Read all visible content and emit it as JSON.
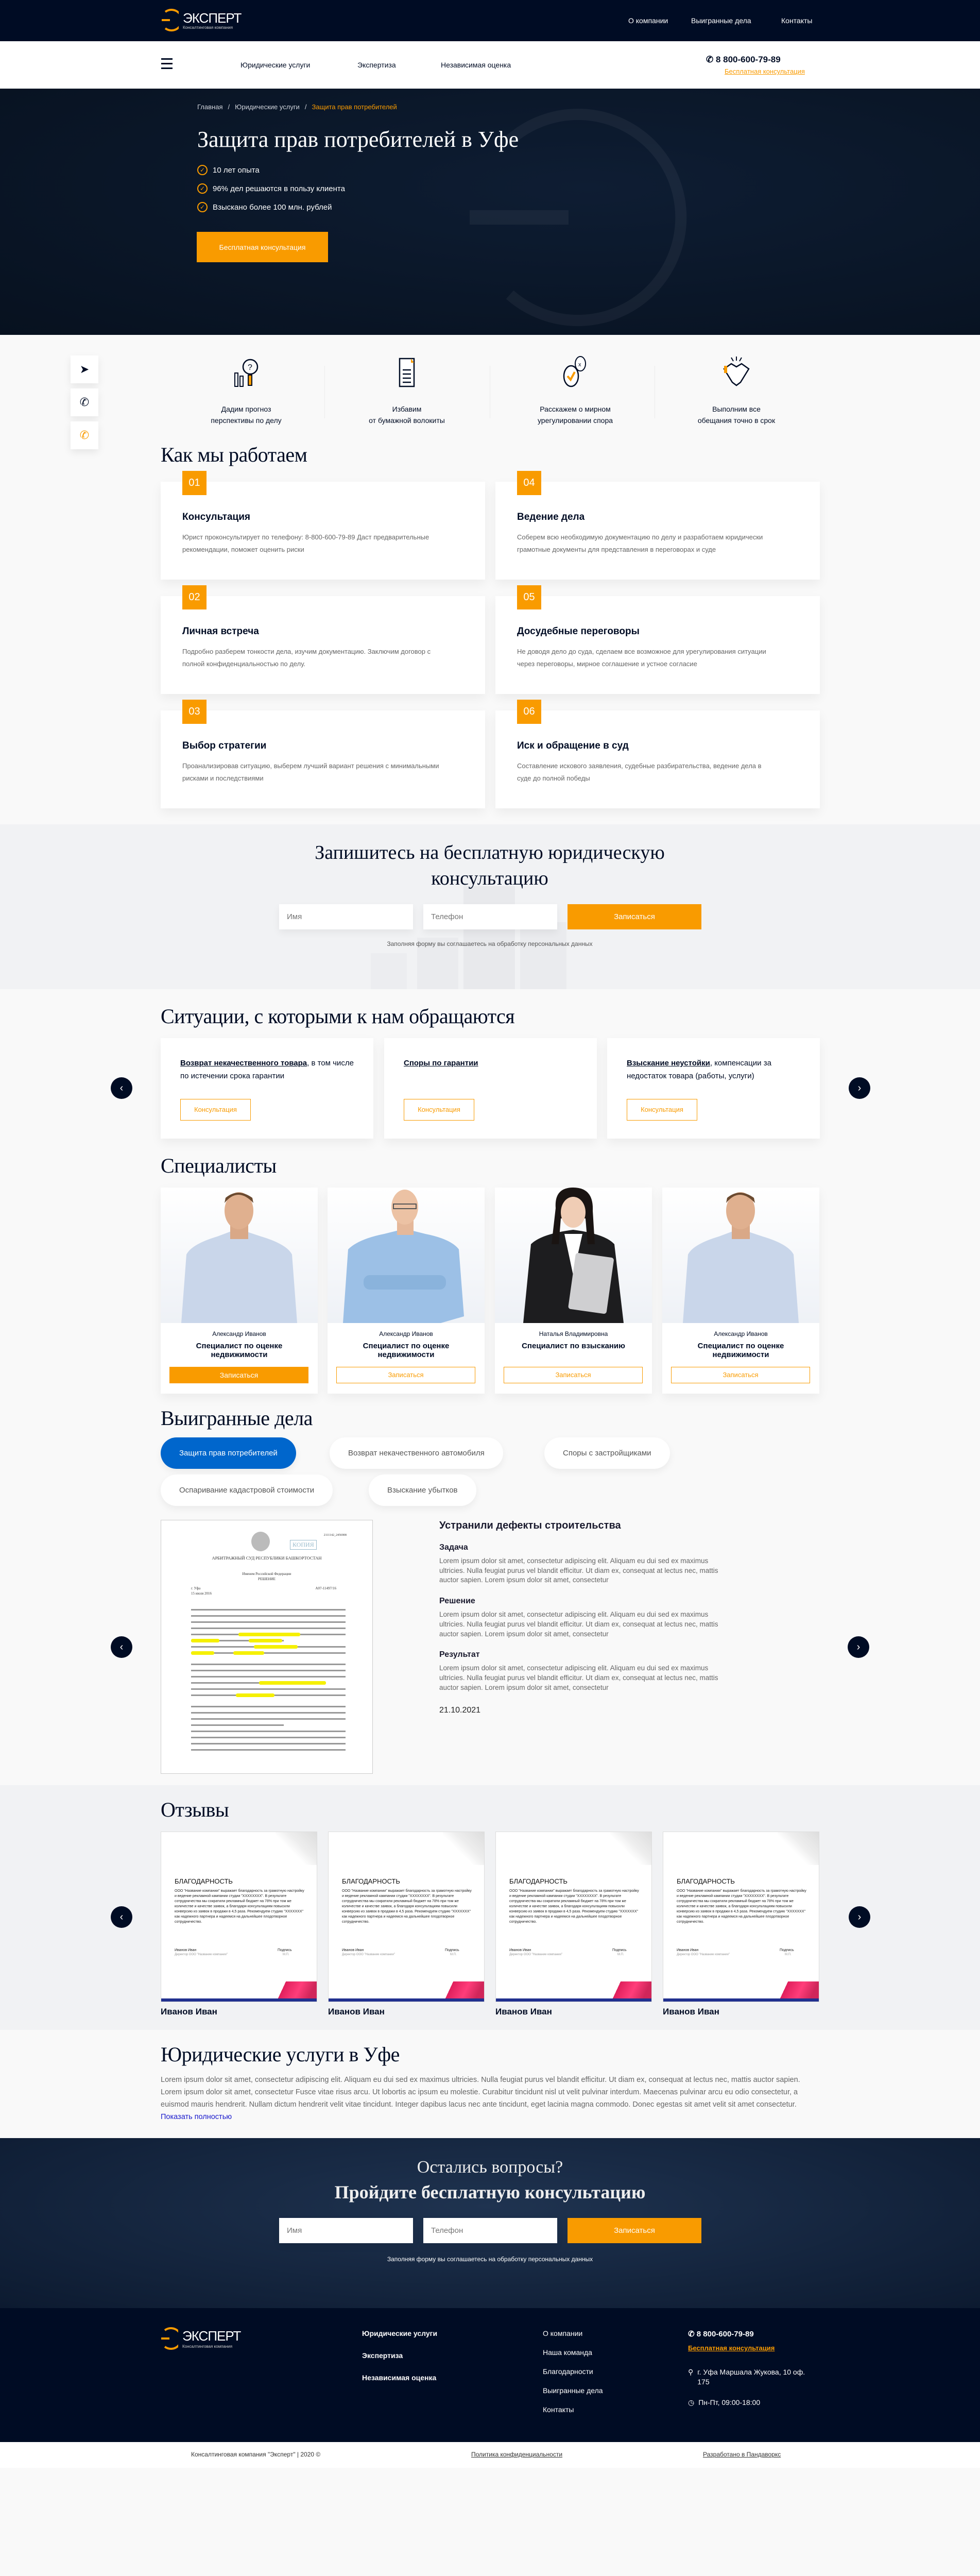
{
  "colors": {
    "navy": "#000c24",
    "accent": "#f99b00",
    "tab_active": "#0066cc"
  },
  "header": {
    "logo_title": "ЭКСПЕРТ",
    "logo_subtitle": "Консалтинговая компания",
    "top_links": [
      "О компании",
      "Выигранные дела",
      "Контакты"
    ],
    "nav": [
      "Юридические услуги",
      "Экспертиза",
      "Независимая оценка"
    ],
    "menu_icon": "hamburger-icon",
    "phone": "8 800-600-79-89",
    "consult_link": "Бесплатная консультация"
  },
  "hero": {
    "breadcrumbs": [
      "Главная",
      "Юридические услуги",
      "Защита прав потребителей"
    ],
    "separator": "/",
    "title": "Защита прав потребителей в Уфе",
    "bullets": [
      "10 лет опыта",
      "96% дел решаются в пользу клиента",
      "Взыскано более 100 млн. рублей"
    ],
    "button": "Бесплатная консультация"
  },
  "social": [
    {
      "icon": "telegram-icon"
    },
    {
      "icon": "whatsapp-icon"
    },
    {
      "icon": "viber-icon"
    }
  ],
  "features": [
    {
      "icon": "forecast-icon",
      "lines": [
        "Дадим прогноз",
        "перспективы по делу"
      ]
    },
    {
      "icon": "document-icon",
      "lines": [
        "Избавим",
        "от бумажной волокиты"
      ]
    },
    {
      "icon": "dialog-icon",
      "lines": [
        "Расскажем о мирном",
        "урегулировании спора"
      ]
    },
    {
      "icon": "handshake-icon",
      "lines": [
        "Выполним все",
        "обещания точно в срок"
      ]
    }
  ],
  "how": {
    "title": "Как мы работаем",
    "steps": [
      {
        "num": "01",
        "title": "Консультация",
        "text": "Юрист проконсультирует по телефону: 8-800-600-79-89 Даст предварительные рекомендации, поможет оценить риски"
      },
      {
        "num": "02",
        "title": "Личная встреча",
        "text": "Подробно разберем тонкости дела, изучим документацию. Заключим договор с полной конфиденциальностью по делу."
      },
      {
        "num": "03",
        "title": "Выбор стратегии",
        "text": "Проанализировав ситуацию, выберем лучший вариант решения с минимальными рисками и последствиями"
      },
      {
        "num": "04",
        "title": "Ведение дела",
        "text": "Соберем всю необходимую документацию по делу и разработаем юридически грамотные документы для представления в переговорах и суде"
      },
      {
        "num": "05",
        "title": "Досудебные переговоры",
        "text": "Не доводя дело до суда, сделаем все возможное для урегулирования ситуации через переговоры, мирное соглашение и устное согласие"
      },
      {
        "num": "06",
        "title": "Иск и обращение в суд",
        "text": "Составление искового заявления, судебные разбирательства, ведение дела в суде до полной победы"
      }
    ]
  },
  "consult": {
    "title": "Запишитесь на бесплатную юридическую консультацию",
    "name_placeholder": "Имя",
    "phone_placeholder": "Телефон",
    "button": "Записаться",
    "consent": "Заполняя форму вы соглашаетесь на обработку персональных данных"
  },
  "situations": {
    "title": "Ситуации, с которыми к нам обращаются",
    "items": [
      {
        "link": "Возврат некачественного товара",
        "rest": ", в том числе по истечении срока гарантии",
        "button": "Консультация"
      },
      {
        "link": "Споры по гарантии",
        "rest": "",
        "button": "Консультация"
      },
      {
        "link": "Взыскание неустойки",
        "rest": ", компенсации за недостаток товара (работы, услуги)",
        "button": "Консультация"
      }
    ],
    "prev": "‹",
    "next": "›"
  },
  "specialists": {
    "title": "Специалисты",
    "items": [
      {
        "name": "Александр Иванов",
        "role": "Специалист по оценке недвижимости",
        "button": "Записаться",
        "photo": "man-blue-shirt"
      },
      {
        "name": "Александр Иванов",
        "role": "Специалист по оценке недвижимости",
        "button": "Записаться",
        "photo": "man-glasses"
      },
      {
        "name": "Наталья Владимировна",
        "role": "Специалист по взысканию",
        "button": "Записаться",
        "photo": "woman-suit"
      },
      {
        "name": "Александр Иванов",
        "role": "Специалист по оценке недвижимости",
        "button": "Записаться",
        "photo": "man-blue-shirt"
      }
    ]
  },
  "cases": {
    "title": "Выигранные дела",
    "tabs": [
      "Защита прав потребителей",
      "Возврат некачественного автомобиля",
      "Споры с застройщиками",
      "Оспаривание кадастровой стоимости",
      "Взыскание убытков"
    ],
    "active_tab": 0,
    "document": {
      "number": "2111142_2456908",
      "stamp": "КОПИЯ",
      "court": "АРБИТРАЖНЫЙ СУД РЕСПУБЛИКИ БАШКОРТОСТАН",
      "name": "Именем Российской Федерации",
      "kind": "РЕШЕНИЕ",
      "city": "г. Уфа",
      "date": "15 июля 2016",
      "case_no": "А07-11497/16"
    },
    "case": {
      "title": "Устранили дефекты строительства",
      "sections": [
        {
          "heading": "Задача",
          "text": "Lorem ipsum dolor sit amet, consectetur adipiscing elit. Aliquam eu dui sed ex maximus ultricies. Nulla feugiat purus vel blandit efficitur. Ut diam ex, consequat at lectus nec, mattis auctor sapien. Lorem ipsum dolor sit amet, consectetur"
        },
        {
          "heading": "Решение",
          "text": "Lorem ipsum dolor sit amet, consectetur adipiscing elit. Aliquam eu dui sed ex maximus ultricies. Nulla feugiat purus vel blandit efficitur. Ut diam ex, consequat at lectus nec, mattis auctor sapien. Lorem ipsum dolor sit amet, consectetur"
        },
        {
          "heading": "Результат",
          "text": "Lorem ipsum dolor sit amet, consectetur adipiscing elit. Aliquam eu dui sed ex maximus ultricies. Nulla feugiat purus vel blandit efficitur. Ut diam ex, consequat at lectus nec, mattis auctor sapien. Lorem ipsum dolor sit amet, consectetur"
        }
      ],
      "date": "21.10.2021"
    }
  },
  "reviews": {
    "title": "Отзывы",
    "items": [
      {
        "doc_title": "БЛАГОДАРНОСТЬ",
        "text": "ООО \"Название компании\" выражает благодарность за грамотную настройку и ведение рекламной кампании студии \"XXXXXXXX\". В результате сотрудничества мы сократили рекламный бюджет на 78% при том же количестве и качестве заявок, а благодаря консультациям повысили конверсию из заявок в продажи в 4,5 раза. Рекомендуем студию \"XXXXXXX\" как надежного партнера и надеемся на дальнейшее плодотворное сотрудничество.",
        "signer": "Иванов Иван",
        "position": "Директор ООО \"Название компании\"",
        "sign": "Подпись",
        "seal": "М.П.",
        "author": "Иванов Иван"
      },
      {
        "doc_title": "БЛАГОДАРНОСТЬ",
        "text": "ООО \"Название компании\" выражает благодарность за грамотную настройку и ведение рекламной кампании студии \"XXXXXXXX\". В результате сотрудничества мы сократили рекламный бюджет на 78% при том же количестве и качестве заявок, а благодаря консультациям повысили конверсию из заявок в продажи в 4,5 раза. Рекомендуем студию \"XXXXXXX\" как надежного партнера и надеемся на дальнейшее плодотворное сотрудничество.",
        "signer": "Иванов Иван",
        "position": "Директор ООО \"Название компании\"",
        "sign": "Подпись",
        "seal": "М.П.",
        "author": "Иванов Иван"
      },
      {
        "doc_title": "БЛАГОДАРНОСТЬ",
        "text": "ООО \"Название компании\" выражает благодарность за грамотную настройку и ведение рекламной кампании студии \"XXXXXXXX\". В результате сотрудничества мы сократили рекламный бюджет на 78% при том же количестве и качестве заявок, а благодаря консультациям повысили конверсию из заявок в продажи в 4,5 раза. Рекомендуем студию \"XXXXXXX\" как надежного партнера и надеемся на дальнейшее плодотворное сотрудничество.",
        "signer": "Иванов Иван",
        "position": "Директор ООО \"Название компании\"",
        "sign": "Подпись",
        "seal": "М.П.",
        "author": "Иванов Иван"
      },
      {
        "doc_title": "БЛАГОДАРНОСТЬ",
        "text": "ООО \"Название компании\" выражает благодарность за грамотную настройку и ведение рекламной кампании студии \"XXXXXXXX\". В результате сотрудничества мы сократили рекламный бюджет на 78% при том же количестве и качестве заявок, а благодаря консультациям повысили конверсию из заявок в продажи в 4,5 раза. Рекомендуем студию \"XXXXXXX\" как надежного партнера и надеемся на дальнейшее плодотворное сотрудничество.",
        "signer": "Иванов Иван",
        "position": "Директор ООО \"Название компании\"",
        "sign": "Подпись",
        "seal": "М.П.",
        "author": "Иванов Иван"
      }
    ]
  },
  "seo": {
    "title": "Юридические услуги в Уфе",
    "text": "Lorem ipsum dolor sit amet, consectetur adipiscing elit. Aliquam eu dui sed ex maximus ultricies. Nulla feugiat purus vel blandit efficitur. Ut diam ex, consequat at lectus nec, mattis auctor sapien. Lorem ipsum dolor sit amet, consectetur Fusce vitae risus arcu. Ut lobortis ac ipsum eu molestie. Curabitur tincidunt nisl ut velit pulvinar interdum. Maecenas pulvinar arcu eu odio consectetur, a euismod mauris hendrerit. Nullam dictum hendrerit velit vitae tincidunt. Integer dapibus lacus nec ante tincidunt, eget lacinia magna commodo. Donec egestas sit amet velit sit amet consectetur.",
    "more": "Показать полностью"
  },
  "cta": {
    "line1": "Остались вопросы?",
    "line2": "Пройдите бесплатную консультацию",
    "name_placeholder": "Имя",
    "phone_placeholder": "Телефон",
    "button": "Записаться",
    "consent": "Заполняя форму вы соглашаетесь на обработку персональных данных"
  },
  "footer": {
    "services": [
      "Юридические услуги",
      "Экспертиза",
      "Независимая оценка"
    ],
    "links": [
      "О компании",
      "Наша команда",
      "Благодарности",
      "Выигранные дела",
      "Контакты"
    ],
    "phone": "8 800-600-79-89",
    "consult_link": "Бесплатная консультация",
    "address": "г. Уфа Маршала Жукова, 10 оф. 175",
    "hours": "Пн-Пт, 09:00-18:00",
    "copyright": "Консалтинговая компания \"Эксперт\" | 2020 ©",
    "privacy": "Политика конфиденциальности",
    "developer": "Разработано в Пандаворкс"
  }
}
